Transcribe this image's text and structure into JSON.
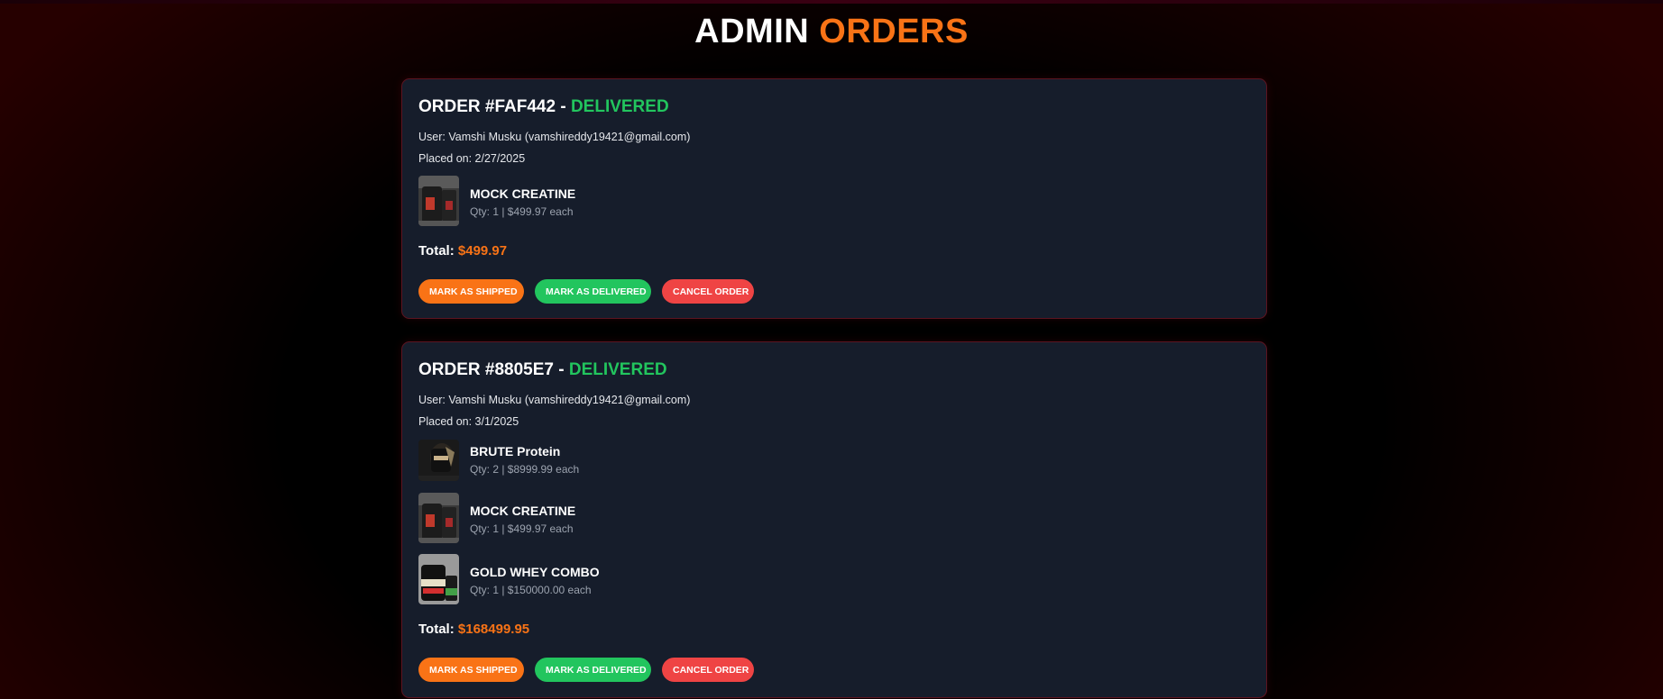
{
  "header": {
    "title_white": "ADMIN",
    "title_orange": "ORDERS"
  },
  "colors": {
    "accent": "#f97316",
    "delivered": "#22c55e",
    "cancel": "#ef4444",
    "card_bg": "#161d2b",
    "card_border": "#5c1420"
  },
  "orders": [
    {
      "heading_prefix": "ORDER #FAF442 - ",
      "status": "DELIVERED",
      "user_line": "User: Vamshi Musku (vamshireddy19421@gmail.com)",
      "placed_line": "Placed on: 2/27/2025",
      "items": [
        {
          "name": "MOCK CREATINE",
          "qty_line": "Qty: 1 | $499.97 each",
          "image_icon": "creatine-product-image"
        }
      ],
      "total_label": "Total:",
      "total_value": "$499.97",
      "buttons": {
        "ship": "MARK AS SHIPPED",
        "deliver": "MARK AS DELIVERED",
        "cancel": "CANCEL ORDER"
      }
    },
    {
      "heading_prefix": "ORDER #8805E7 - ",
      "status": "DELIVERED",
      "user_line": "User: Vamshi Musku (vamshireddy19421@gmail.com)",
      "placed_line": "Placed on: 3/1/2025",
      "items": [
        {
          "name": "BRUTE Protein",
          "qty_line": "Qty: 2 | $8999.99 each",
          "image_icon": "protein-product-image"
        },
        {
          "name": "MOCK CREATINE",
          "qty_line": "Qty: 1 | $499.97 each",
          "image_icon": "creatine-product-image"
        },
        {
          "name": "GOLD WHEY COMBO",
          "qty_line": "Qty: 1 | $150000.00 each",
          "image_icon": "whey-product-image"
        }
      ],
      "total_label": "Total:",
      "total_value": "$168499.95",
      "buttons": {
        "ship": "MARK AS SHIPPED",
        "deliver": "MARK AS DELIVERED",
        "cancel": "CANCEL ORDER"
      }
    }
  ]
}
